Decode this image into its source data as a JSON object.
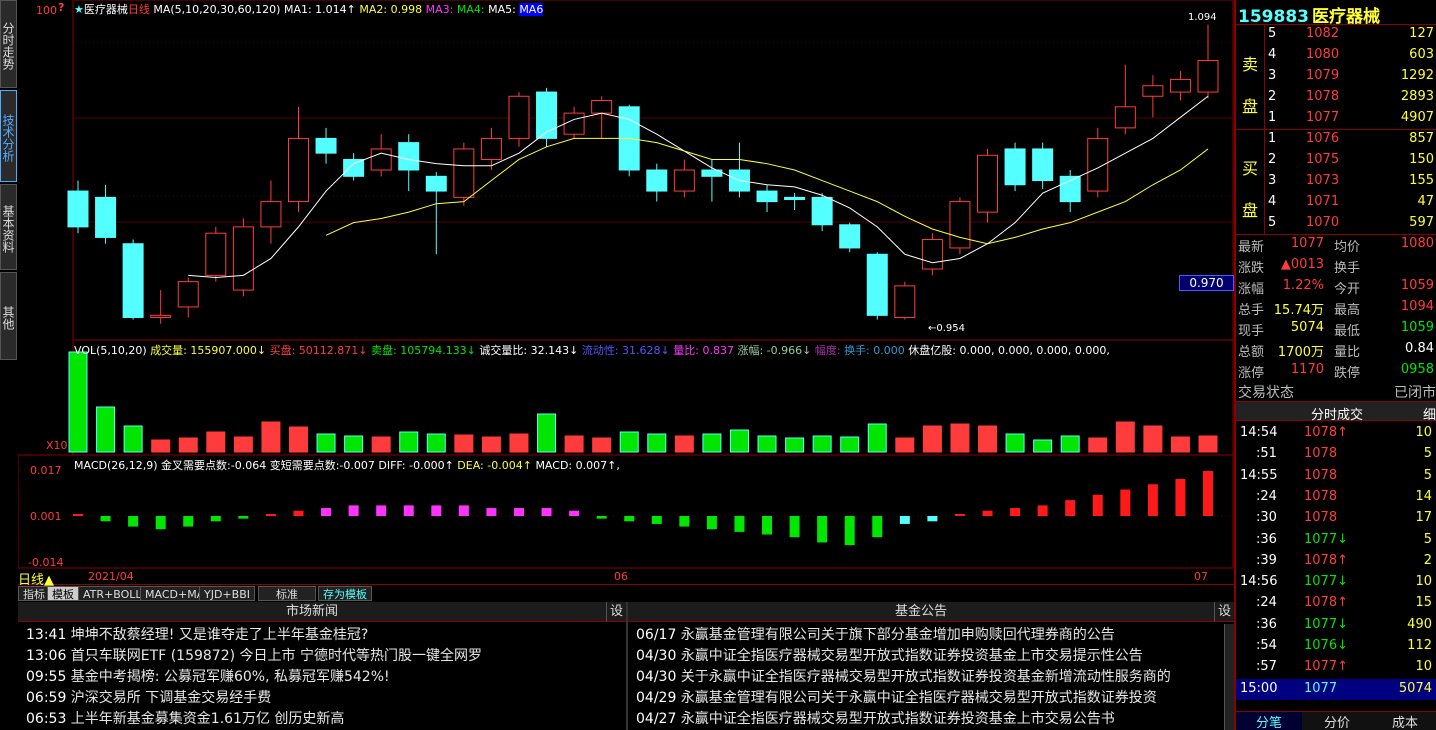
{
  "side_tabs": [
    "分时走势",
    "技术分析",
    "基本资料",
    "其他"
  ],
  "chart_header": {
    "title": "医疗器械",
    "period": "日线",
    "ma_spec": "MA(5,10,20,30,60,120)",
    "ma1": "MA1: 1.014↑",
    "ma2": "MA2: 0.998",
    "ma3": "MA3:",
    "ma4": "MA4:",
    "ma5": "MA5:",
    "ma6": "MA6"
  },
  "price_marks": {
    "high": "1.094",
    "low": "0.954",
    "current": "0.970",
    "top_left": "100"
  },
  "vol_header": {
    "spec": "VOL(5,10,20)",
    "chengjiao": "成交量: 155907.000↓",
    "maipan": "买盘: 50112.871↓",
    "maipan2": "卖盘: 105794.133↓",
    "ratio": "诚交量比: 32.143↓",
    "net": "流动性:  31.628↓",
    "liangbi": "量比: 0.837",
    "zhangfu": "涨幅: -0.966↓",
    "fudu": "幅度:",
    "huanshou": "换手: 0.000",
    "tipan": "休盘亿股: 0.000, 0.000, 0.000, 0.000,",
    "x10": "X10"
  },
  "macd_header": {
    "spec": "MACD(26,12,9)",
    "a": "金叉需要点数:-0.064",
    "b": "变短需要点数:-0.007",
    "diff": "DIFF: -0.000↑",
    "dea": "DEA: -0.004↑",
    "macd": "MACD: 0.007↑,"
  },
  "macd_axis": [
    "0.017",
    "0.001",
    "-0.014"
  ],
  "date_axis": {
    "period": "日线▲",
    "d1": "2021/04",
    "d2": "06",
    "d3": "07"
  },
  "bottom_tabs": [
    "指标",
    "模板",
    "ATR+BOLL",
    "MACD+MA",
    "YJD+BBI",
    "标准",
    "存为模板"
  ],
  "quote": {
    "code": "159883",
    "name": "医疗器械",
    "sell_label": [
      "卖",
      "盘"
    ],
    "buy_label": [
      "买",
      "盘"
    ],
    "sells": [
      {
        "lvl": "5",
        "price": "1082",
        "vol": "127"
      },
      {
        "lvl": "4",
        "price": "1080",
        "vol": "603"
      },
      {
        "lvl": "3",
        "price": "1079",
        "vol": "1292"
      },
      {
        "lvl": "2",
        "price": "1078",
        "vol": "2893"
      },
      {
        "lvl": "1",
        "price": "1077",
        "vol": "4907"
      }
    ],
    "buys": [
      {
        "lvl": "1",
        "price": "1076",
        "vol": "857"
      },
      {
        "lvl": "2",
        "price": "1075",
        "vol": "150"
      },
      {
        "lvl": "3",
        "price": "1073",
        "vol": "155"
      },
      {
        "lvl": "4",
        "price": "1071",
        "vol": "47"
      },
      {
        "lvl": "5",
        "price": "1070",
        "vol": "597"
      }
    ],
    "stats": [
      {
        "l1": "最新",
        "v1": "1077",
        "l2": "均价",
        "v2": "1080"
      },
      {
        "l1": "涨跌",
        "v1": "▲0013",
        "l2": "换手",
        "v2": ""
      },
      {
        "l1": "涨幅",
        "v1": "1.22%",
        "l2": "今开",
        "v2": "1059"
      },
      {
        "l1": "总手",
        "v1": "15.74万",
        "l2": "最高",
        "v2": "1094"
      },
      {
        "l1": "现手",
        "v1": "5074",
        "l2": "最低",
        "v2": "1059"
      },
      {
        "l1": "总额",
        "v1": "1700万",
        "l2": "量比",
        "v2": "0.84"
      },
      {
        "l1": "涨停",
        "v1": "1170",
        "l2": "跌停",
        "v2": "0958"
      }
    ],
    "status_label": "交易状态",
    "status_value": "已闭市"
  },
  "ticks_header": {
    "title": "分时成交",
    "btn": "细"
  },
  "ticks": [
    {
      "t": "14:54",
      "p": "1078↑",
      "v": "10",
      "c": "red"
    },
    {
      "t": ":51",
      "p": "1078",
      "v": "5",
      "c": "red"
    },
    {
      "t": "14:55",
      "p": "1078",
      "v": "5",
      "c": "red"
    },
    {
      "t": ":24",
      "p": "1078",
      "v": "14",
      "c": "red"
    },
    {
      "t": ":30",
      "p": "1078",
      "v": "17",
      "c": "red"
    },
    {
      "t": ":36",
      "p": "1077↓",
      "v": "5",
      "c": "green"
    },
    {
      "t": ":39",
      "p": "1078↑",
      "v": "2",
      "c": "red"
    },
    {
      "t": "14:56",
      "p": "1077↓",
      "v": "10",
      "c": "green"
    },
    {
      "t": ":24",
      "p": "1078↑",
      "v": "15",
      "c": "red"
    },
    {
      "t": ":36",
      "p": "1077↓",
      "v": "490",
      "c": "green"
    },
    {
      "t": ":54",
      "p": "1076↓",
      "v": "112",
      "c": "green"
    },
    {
      "t": ":57",
      "p": "1077↑",
      "v": "10",
      "c": "red"
    },
    {
      "t": "15:00",
      "p": "1077",
      "v": "5074",
      "c": "red"
    }
  ],
  "tick_tabs": [
    "分笔",
    "分价",
    "成本"
  ],
  "news": {
    "title": "市场新闻",
    "set": "设",
    "items": [
      {
        "t": "13:41",
        "s": "坤坤不敌蔡经理! 又是谁夺走了上半年基金桂冠?"
      },
      {
        "t": "13:06",
        "s": "首只车联网ETF (159872) 今日上市 宁德时代等热门股一键全网罗"
      },
      {
        "t": "09:55",
        "s": "基金中考揭榜: 公募冠军赚60%, 私募冠军赚542%!"
      },
      {
        "t": "06:59",
        "s": "沪深交易所 下调基金交易经手费"
      },
      {
        "t": "06:53",
        "s": "上半年新基金募集资金1.61万亿 创历史新高"
      }
    ]
  },
  "notice": {
    "title": "基金公告",
    "set": "设",
    "items": [
      {
        "t": "06/17",
        "s": "永赢基金管理有限公司关于旗下部分基金增加申购赎回代理券商的公告"
      },
      {
        "t": "04/30",
        "s": "永赢中证全指医疗器械交易型开放式指数证券投资基金上市交易提示性公告"
      },
      {
        "t": "04/30",
        "s": "关于永赢中证全指医疗器械交易型开放式指数证券投资基金新增流动性服务商的"
      },
      {
        "t": "04/29",
        "s": "永赢基金管理有限公司关于永赢中证全指医疗器械交易型开放式指数证券投资"
      },
      {
        "t": "04/27",
        "s": "永赢中证全指医疗器械交易型开放式指数证券投资基金上市交易公告书"
      }
    ]
  },
  "colors": {
    "up": "#ff3b3b",
    "down": "#54ffff",
    "ma1": "#ffffff",
    "ma2": "#ffff33",
    "ma3": "#ff33ff",
    "ma4": "#33ff33",
    "grid": "#8b0000"
  },
  "chart_data": {
    "type": "candlestick",
    "title": "医疗器械 日线",
    "ylim": [
      0.95,
      1.1
    ],
    "candles": [
      {
        "o": 1.015,
        "c": 0.998,
        "h": 1.02,
        "l": 0.995
      },
      {
        "o": 1.012,
        "c": 0.993,
        "h": 1.018,
        "l": 0.99
      },
      {
        "o": 0.99,
        "c": 0.955,
        "h": 0.992,
        "l": 0.954
      },
      {
        "o": 0.955,
        "c": 0.956,
        "h": 0.968,
        "l": 0.952
      },
      {
        "o": 0.96,
        "c": 0.972,
        "h": 0.974,
        "l": 0.955
      },
      {
        "o": 0.975,
        "c": 0.995,
        "h": 0.998,
        "l": 0.972
      },
      {
        "o": 0.968,
        "c": 0.998,
        "h": 1.002,
        "l": 0.965
      },
      {
        "o": 0.998,
        "c": 1.01,
        "h": 1.02,
        "l": 0.99
      },
      {
        "o": 1.01,
        "c": 1.04,
        "h": 1.055,
        "l": 1.005
      },
      {
        "o": 1.04,
        "c": 1.033,
        "h": 1.045,
        "l": 1.028
      },
      {
        "o": 1.03,
        "c": 1.022,
        "h": 1.033,
        "l": 1.02
      },
      {
        "o": 1.025,
        "c": 1.035,
        "h": 1.042,
        "l": 1.022
      },
      {
        "o": 1.038,
        "c": 1.025,
        "h": 1.042,
        "l": 1.015
      },
      {
        "o": 1.022,
        "c": 1.015,
        "h": 1.024,
        "l": 0.985
      },
      {
        "o": 1.012,
        "c": 1.035,
        "h": 1.038,
        "l": 1.008
      },
      {
        "o": 1.03,
        "c": 1.04,
        "h": 1.045,
        "l": 1.025
      },
      {
        "o": 1.04,
        "c": 1.06,
        "h": 1.062,
        "l": 1.036
      },
      {
        "o": 1.062,
        "c": 1.04,
        "h": 1.064,
        "l": 1.036
      },
      {
        "o": 1.042,
        "c": 1.052,
        "h": 1.055,
        "l": 1.04
      },
      {
        "o": 1.052,
        "c": 1.058,
        "h": 1.06,
        "l": 1.04
      },
      {
        "o": 1.055,
        "c": 1.025,
        "h": 1.056,
        "l": 1.022
      },
      {
        "o": 1.025,
        "c": 1.015,
        "h": 1.028,
        "l": 1.01
      },
      {
        "o": 1.015,
        "c": 1.025,
        "h": 1.03,
        "l": 1.012
      },
      {
        "o": 1.025,
        "c": 1.022,
        "h": 1.03,
        "l": 1.01
      },
      {
        "o": 1.025,
        "c": 1.015,
        "h": 1.038,
        "l": 1.012
      },
      {
        "o": 1.015,
        "c": 1.01,
        "h": 1.018,
        "l": 1.005
      },
      {
        "o": 1.012,
        "c": 1.011,
        "h": 1.014,
        "l": 1.006
      },
      {
        "o": 1.012,
        "c": 0.999,
        "h": 1.014,
        "l": 0.996
      },
      {
        "o": 0.999,
        "c": 0.988,
        "h": 1.0,
        "l": 0.986
      },
      {
        "o": 0.985,
        "c": 0.956,
        "h": 0.986,
        "l": 0.954
      },
      {
        "o": 0.955,
        "c": 0.97,
        "h": 0.972,
        "l": 0.954
      },
      {
        "o": 0.978,
        "c": 0.992,
        "h": 0.995,
        "l": 0.975
      },
      {
        "o": 0.988,
        "c": 1.01,
        "h": 1.012,
        "l": 0.985
      },
      {
        "o": 1.005,
        "c": 1.032,
        "h": 1.035,
        "l": 1.0
      },
      {
        "o": 1.035,
        "c": 1.018,
        "h": 1.038,
        "l": 1.015
      },
      {
        "o": 1.035,
        "c": 1.02,
        "h": 1.038,
        "l": 1.016
      },
      {
        "o": 1.022,
        "c": 1.01,
        "h": 1.025,
        "l": 1.005
      },
      {
        "o": 1.015,
        "c": 1.04,
        "h": 1.045,
        "l": 1.012
      },
      {
        "o": 1.045,
        "c": 1.055,
        "h": 1.075,
        "l": 1.042
      },
      {
        "o": 1.06,
        "c": 1.065,
        "h": 1.07,
        "l": 1.05
      },
      {
        "o": 1.062,
        "c": 1.068,
        "h": 1.072,
        "l": 1.058
      },
      {
        "o": 1.062,
        "c": 1.077,
        "h": 1.094,
        "l": 1.059
      }
    ],
    "volume": [
      100,
      45,
      26,
      12,
      14,
      20,
      15,
      30,
      25,
      18,
      16,
      15,
      20,
      18,
      17,
      15,
      18,
      38,
      16,
      14,
      20,
      18,
      16,
      18,
      22,
      16,
      14,
      16,
      15,
      28,
      14,
      26,
      28,
      26,
      18,
      12,
      16,
      14,
      30,
      26,
      15,
      16
    ],
    "macd": [
      0.0,
      -0.002,
      -0.004,
      -0.005,
      -0.004,
      -0.002,
      -0.001,
      0.0,
      0.002,
      0.003,
      0.004,
      0.004,
      0.004,
      0.004,
      0.004,
      0.003,
      0.003,
      0.003,
      0.002,
      -0.001,
      -0.002,
      -0.003,
      -0.004,
      -0.005,
      -0.006,
      -0.007,
      -0.008,
      -0.01,
      -0.011,
      -0.008,
      -0.003,
      -0.002,
      0.0,
      0.002,
      0.003,
      0.004,
      0.006,
      0.008,
      0.01,
      0.012,
      0.014,
      0.017
    ],
    "ma5": [
      null,
      null,
      null,
      null,
      0.975,
      0.974,
      0.975,
      0.983,
      0.998,
      1.015,
      1.028,
      1.033,
      1.03,
      1.028,
      1.027,
      1.027,
      1.033,
      1.043,
      1.049,
      1.052,
      1.049,
      1.042,
      1.034,
      1.026,
      1.02,
      1.018,
      1.017,
      1.013,
      1.007,
      0.998,
      0.985,
      0.981,
      0.983,
      0.99,
      1.0,
      1.014,
      1.02,
      1.026,
      1.033,
      1.04,
      1.05,
      1.06
    ],
    "ma10": [
      null,
      null,
      null,
      null,
      null,
      null,
      null,
      null,
      null,
      0.994,
      1.0,
      1.002,
      1.005,
      1.009,
      1.01,
      1.02,
      1.03,
      1.036,
      1.04,
      1.04,
      1.04,
      1.038,
      1.034,
      1.03,
      1.03,
      1.028,
      1.025,
      1.02,
      1.015,
      1.01,
      1.003,
      0.997,
      0.993,
      0.99,
      0.993,
      0.997,
      1.0,
      1.005,
      1.01,
      1.018,
      1.025,
      1.035
    ]
  }
}
